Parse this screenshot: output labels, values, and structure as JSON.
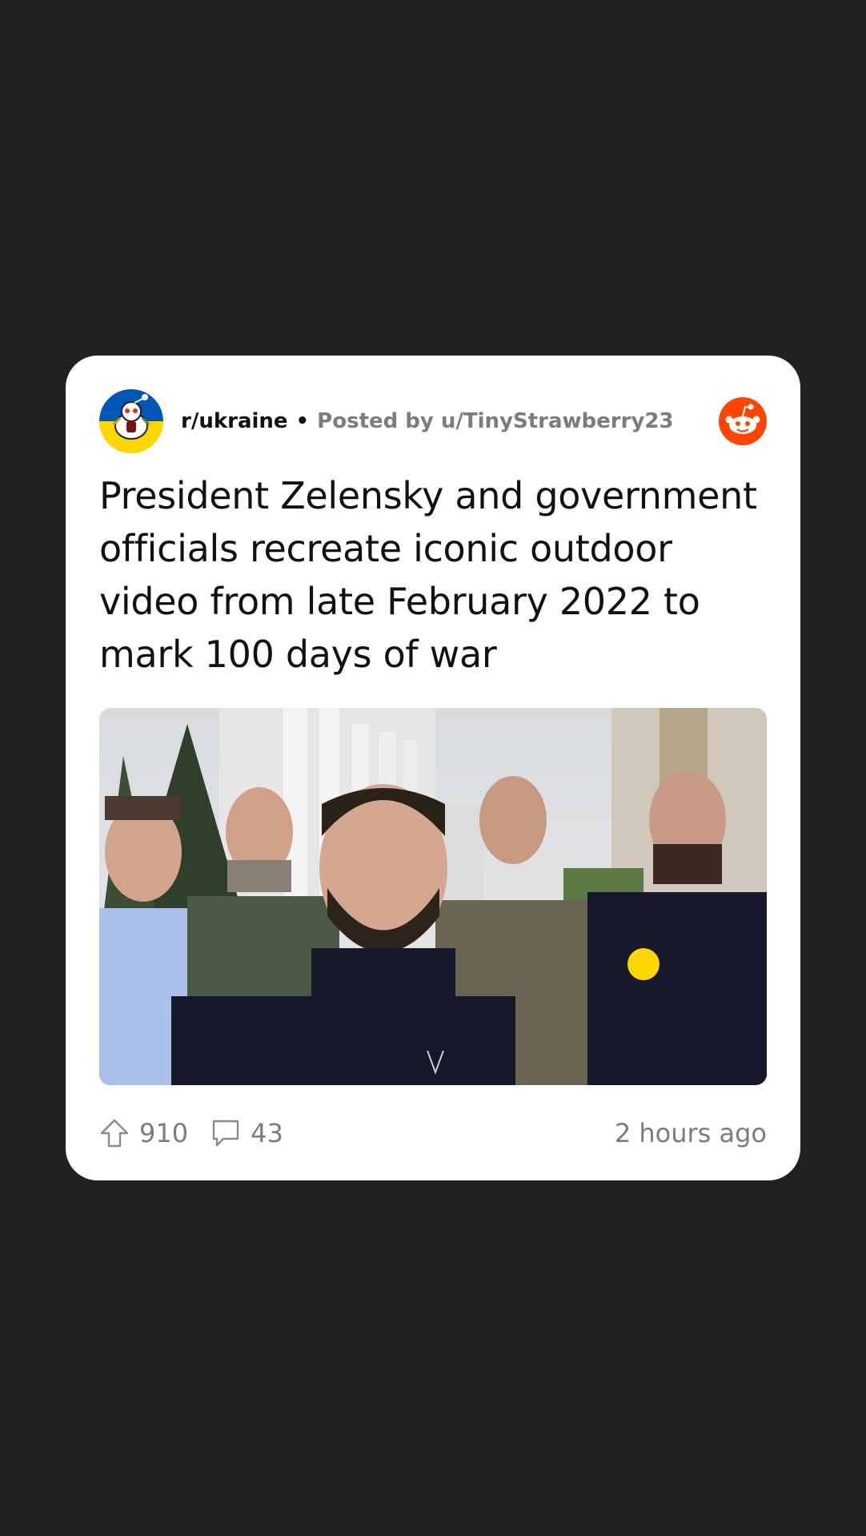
{
  "post": {
    "subreddit": "r/ukraine",
    "separator": "•",
    "posted_by": "Posted by u/TinyStrawberry23",
    "title": "President Zelensky and government officials recreate iconic outdoor video from late February 2022 to mark 100 days of war",
    "image_alt": "President Zelensky and government officials in front of a building",
    "upvotes": "910",
    "comments": "43",
    "timestamp": "2 hours ago"
  },
  "icons": {
    "avatar": "subreddit-avatar-icon",
    "brand": "reddit-logo-icon",
    "upvote": "upvote-arrow-icon",
    "comment": "comment-bubble-icon"
  },
  "colors": {
    "background": "#212121",
    "card": "#ffffff",
    "reddit_orange": "#ff4500",
    "muted_text": "#7c7c7c",
    "ukraine_blue": "#0057b7",
    "ukraine_yellow": "#ffd700"
  }
}
